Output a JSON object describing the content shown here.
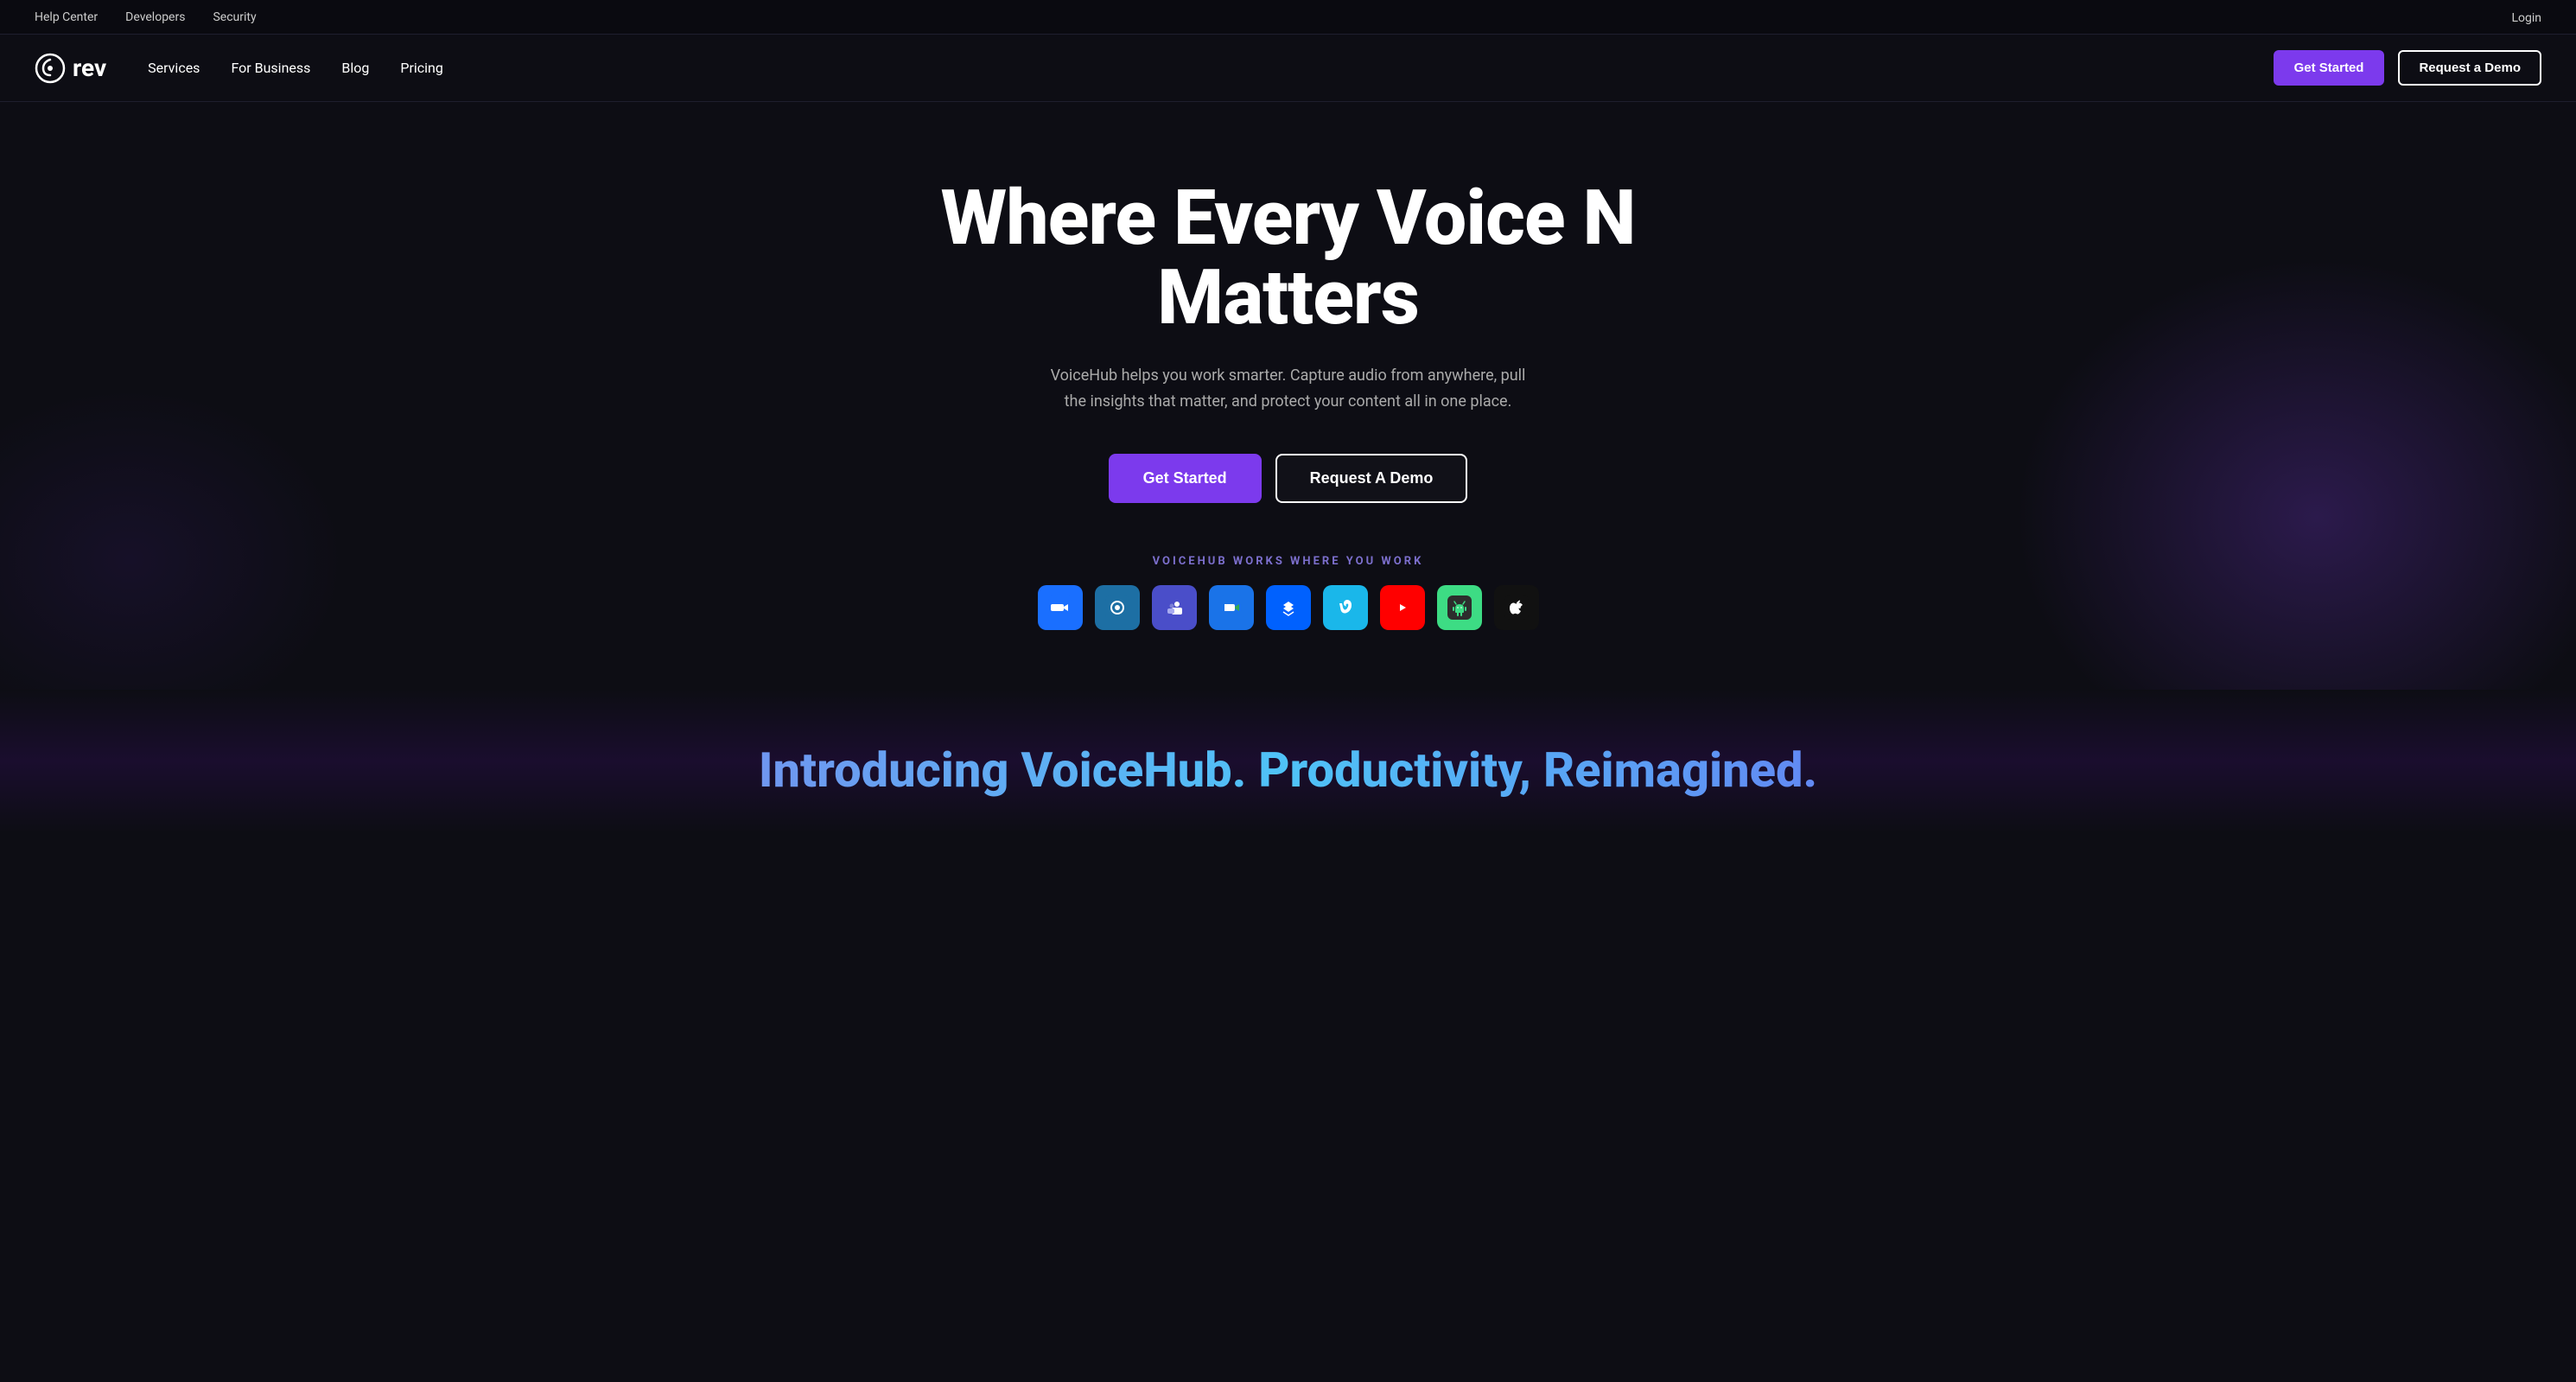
{
  "topbar": {
    "links": [
      {
        "label": "Help Center",
        "name": "help-center-link"
      },
      {
        "label": "Developers",
        "name": "developers-link"
      },
      {
        "label": "Security",
        "name": "security-link"
      }
    ],
    "login_label": "Login"
  },
  "nav": {
    "logo_text": "rev",
    "links": [
      {
        "label": "Services",
        "name": "services-link"
      },
      {
        "label": "For Business",
        "name": "for-business-link"
      },
      {
        "label": "Blog",
        "name": "blog-link"
      },
      {
        "label": "Pricing",
        "name": "pricing-link"
      }
    ],
    "get_started_label": "Get Started",
    "request_demo_label": "Request a Demo"
  },
  "hero": {
    "title": "Where Every Voice N Matters",
    "subtitle": "VoiceHub helps you work smarter. Capture audio from anywhere, pull the insights that matter, and protect your content all in one place.",
    "get_started_label": "Get Started",
    "request_demo_label": "Request A Demo",
    "integration_label": "VOICEHUB WORKS WHERE YOU WORK",
    "integrations": [
      {
        "name": "zoom-icon",
        "label": "Zoom",
        "css_class": "icon-zoom",
        "symbol": "🎥"
      },
      {
        "name": "webex-icon",
        "label": "Webex",
        "css_class": "icon-webex",
        "symbol": "🔵"
      },
      {
        "name": "teams-icon",
        "label": "Microsoft Teams",
        "css_class": "icon-teams",
        "symbol": "👥"
      },
      {
        "name": "meet-icon",
        "label": "Google Meet",
        "css_class": "icon-meet",
        "symbol": "🟦"
      },
      {
        "name": "dropbox-icon",
        "label": "Dropbox",
        "css_class": "icon-dropbox",
        "symbol": "📦"
      },
      {
        "name": "vimeo-icon",
        "label": "Vimeo",
        "css_class": "icon-vimeo",
        "symbol": "▶"
      },
      {
        "name": "youtube-icon",
        "label": "YouTube",
        "css_class": "icon-youtube",
        "symbol": "▶"
      },
      {
        "name": "android-icon",
        "label": "Android",
        "css_class": "icon-android",
        "symbol": "🤖"
      },
      {
        "name": "apple-icon",
        "label": "Apple",
        "css_class": "icon-apple",
        "symbol": "🍎"
      }
    ]
  },
  "bottom": {
    "title": "Introducing VoiceHub. Productivity, Reimagined."
  }
}
